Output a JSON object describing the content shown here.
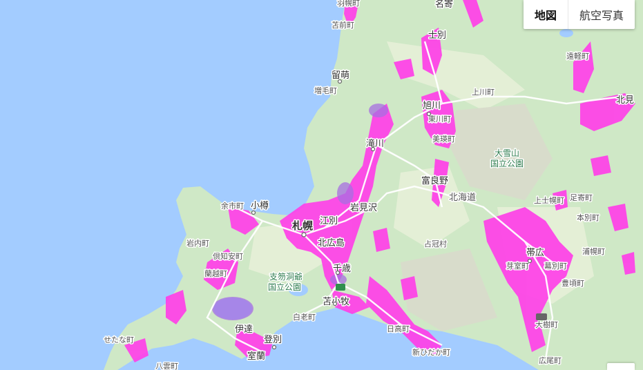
{
  "map_type": {
    "map_label": "地図",
    "satellite_label": "航空写真"
  },
  "labels": {
    "haboro": "羽幌町",
    "tomamae": "苫前町",
    "rumoi": "留萌",
    "mashike": "増毛町",
    "nayoro": "名寄",
    "shibetsu": "士別",
    "engaru": "遠軽町",
    "kamikawa": "上川町",
    "asahikawa": "旭川",
    "higashikawa": "東川町",
    "biei": "美瑛町",
    "kitami": "北見",
    "taisetsu_park": "大雪山\n国立公園",
    "takikawa": "滝川",
    "furano": "富良野",
    "hokkaido": "北海道",
    "otaru": "小樽",
    "yoichi": "余市町",
    "sapporo": "札幌",
    "ebetsu": "江別",
    "iwamizawa": "岩見沢",
    "kitahiroshima": "北広島",
    "iwanai": "岩内町",
    "kutchan": "倶知安町",
    "rankoshi": "蘭越町",
    "shikotsu_park": "支笏洞爺\n国立公園",
    "chitose": "千歳",
    "tomakomai": "苫小牧",
    "shimukappu": "占冠村",
    "kamishihoro": "上士幌町",
    "ashoro": "足寄町",
    "honbetsu": "本別町",
    "obihiro": "帯広",
    "memuro": "芽室町",
    "makubetsu": "幕別町",
    "urahoro": "浦幌町",
    "toyokoro": "豊頃町",
    "shiraoi": "白老町",
    "date": "伊達",
    "noboribetsu": "登別",
    "muroran": "室蘭",
    "hidaka": "日高町",
    "shinhidaka": "新ひだか町",
    "setana": "せたな町",
    "yakumo": "八雲町",
    "taiki": "大樹町",
    "hiroo": "広尾町"
  }
}
